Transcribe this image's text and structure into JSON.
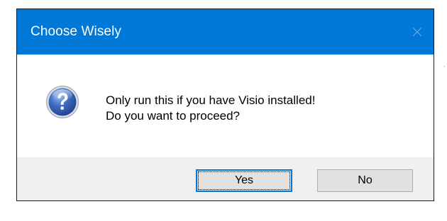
{
  "window": {
    "title": "Choose Wisely",
    "close_icon": "close-icon"
  },
  "message": {
    "icon": "question-icon",
    "line1": "Only run this if you have Visio installed!",
    "line2": "Do you want to proceed?"
  },
  "buttons": {
    "yes_label": "Yes",
    "no_label": "No"
  },
  "colors": {
    "titlebar": "#0078d7",
    "footer": "#f0f0f0",
    "button_face": "#e1e1e1",
    "default_button_border": "#0078d7"
  }
}
